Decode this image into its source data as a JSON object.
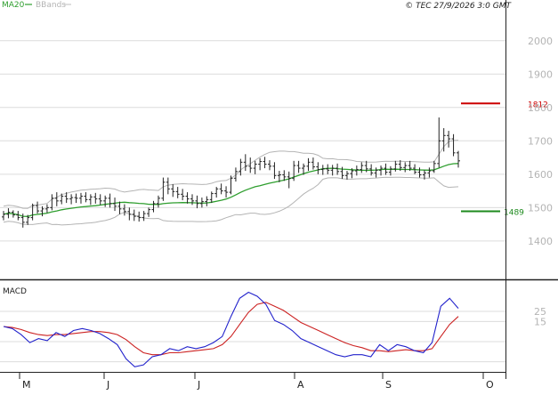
{
  "header": {
    "legend_ma": "MA20",
    "legend_bb": "BBands",
    "copyright": "© TEC 27/9/2026 3:0 GMT"
  },
  "colors": {
    "price_bar": "#222222",
    "ma20": "#2e9e2e",
    "bbands": "#b4b4b4",
    "macd_line": "#2222cc",
    "signal_line": "#cc2222",
    "resistance": "#cc0000",
    "support": "#1e8a1e",
    "grid": "#dcdcdc",
    "axis_text": "#b4b4b4"
  },
  "chart_data": [
    {
      "type": "line",
      "name": "price",
      "ylim": [
        1285,
        2090
      ],
      "yticks": [
        1400,
        1500,
        1600,
        1700,
        1800,
        1900,
        2000
      ],
      "x_months": [
        "M",
        "J",
        "J",
        "A",
        "S",
        "O"
      ],
      "levels": [
        {
          "label": "1812",
          "value": 1812
        },
        {
          "label": "1489",
          "value": 1489
        }
      ],
      "grid": true,
      "ohlc": [
        [
          1472,
          1490,
          1462,
          1480
        ],
        [
          1480,
          1498,
          1468,
          1486
        ],
        [
          1486,
          1492,
          1470,
          1478
        ],
        [
          1478,
          1490,
          1462,
          1470
        ],
        [
          1470,
          1482,
          1440,
          1456
        ],
        [
          1456,
          1478,
          1448,
          1470
        ],
        [
          1470,
          1512,
          1462,
          1506
        ],
        [
          1506,
          1518,
          1482,
          1490
        ],
        [
          1490,
          1504,
          1474,
          1496
        ],
        [
          1496,
          1510,
          1484,
          1500
        ],
        [
          1500,
          1540,
          1492,
          1528
        ],
        [
          1528,
          1546,
          1504,
          1520
        ],
        [
          1520,
          1542,
          1510,
          1534
        ],
        [
          1534,
          1546,
          1514,
          1526
        ],
        [
          1526,
          1540,
          1510,
          1530
        ],
        [
          1530,
          1542,
          1514,
          1528
        ],
        [
          1528,
          1544,
          1512,
          1534
        ],
        [
          1534,
          1546,
          1516,
          1524
        ],
        [
          1524,
          1540,
          1508,
          1532
        ],
        [
          1532,
          1544,
          1512,
          1526
        ],
        [
          1526,
          1540,
          1508,
          1520
        ],
        [
          1520,
          1536,
          1502,
          1528
        ],
        [
          1528,
          1542,
          1500,
          1512
        ],
        [
          1512,
          1530,
          1490,
          1504
        ],
        [
          1504,
          1518,
          1480,
          1496
        ],
        [
          1496,
          1510,
          1476,
          1488
        ],
        [
          1488,
          1500,
          1462,
          1480
        ],
        [
          1480,
          1494,
          1460,
          1474
        ],
        [
          1474,
          1488,
          1458,
          1470
        ],
        [
          1470,
          1490,
          1460,
          1482
        ],
        [
          1482,
          1500,
          1472,
          1494
        ],
        [
          1494,
          1520,
          1486,
          1512
        ],
        [
          1512,
          1536,
          1500,
          1528
        ],
        [
          1528,
          1590,
          1520,
          1576
        ],
        [
          1576,
          1590,
          1540,
          1556
        ],
        [
          1556,
          1570,
          1532,
          1548
        ],
        [
          1548,
          1562,
          1528,
          1540
        ],
        [
          1540,
          1556,
          1522,
          1534
        ],
        [
          1534,
          1546,
          1512,
          1526
        ],
        [
          1526,
          1540,
          1508,
          1520
        ],
        [
          1520,
          1536,
          1498,
          1512
        ],
        [
          1512,
          1530,
          1500,
          1518
        ],
        [
          1518,
          1534,
          1504,
          1524
        ],
        [
          1524,
          1548,
          1514,
          1542
        ],
        [
          1542,
          1562,
          1530,
          1556
        ],
        [
          1556,
          1572,
          1540,
          1550
        ],
        [
          1550,
          1564,
          1530,
          1546
        ],
        [
          1546,
          1596,
          1540,
          1588
        ],
        [
          1588,
          1620,
          1578,
          1608
        ],
        [
          1608,
          1646,
          1596,
          1636
        ],
        [
          1636,
          1660,
          1610,
          1624
        ],
        [
          1624,
          1650,
          1604,
          1618
        ],
        [
          1618,
          1640,
          1600,
          1630
        ],
        [
          1630,
          1648,
          1612,
          1638
        ],
        [
          1638,
          1652,
          1618,
          1630
        ],
        [
          1630,
          1642,
          1612,
          1624
        ],
        [
          1624,
          1636,
          1586,
          1596
        ],
        [
          1596,
          1610,
          1576,
          1598
        ],
        [
          1598,
          1612,
          1580,
          1592
        ],
        [
          1592,
          1608,
          1558,
          1588
        ],
        [
          1588,
          1640,
          1580,
          1626
        ],
        [
          1626,
          1640,
          1604,
          1618
        ],
        [
          1618,
          1632,
          1598,
          1624
        ],
        [
          1624,
          1648,
          1610,
          1636
        ],
        [
          1636,
          1650,
          1614,
          1622
        ],
        [
          1622,
          1636,
          1600,
          1614
        ],
        [
          1614,
          1628,
          1598,
          1616
        ],
        [
          1616,
          1630,
          1600,
          1612
        ],
        [
          1612,
          1628,
          1596,
          1618
        ],
        [
          1618,
          1632,
          1598,
          1608
        ],
        [
          1608,
          1622,
          1586,
          1596
        ],
        [
          1596,
          1610,
          1584,
          1602
        ],
        [
          1602,
          1618,
          1588,
          1610
        ],
        [
          1610,
          1626,
          1596,
          1614
        ],
        [
          1614,
          1636,
          1604,
          1626
        ],
        [
          1626,
          1640,
          1606,
          1616
        ],
        [
          1616,
          1630,
          1596,
          1604
        ],
        [
          1604,
          1620,
          1590,
          1612
        ],
        [
          1612,
          1626,
          1596,
          1618
        ],
        [
          1618,
          1632,
          1598,
          1606
        ],
        [
          1606,
          1624,
          1596,
          1616
        ],
        [
          1616,
          1640,
          1608,
          1630
        ],
        [
          1630,
          1642,
          1610,
          1620
        ],
        [
          1620,
          1636,
          1606,
          1626
        ],
        [
          1626,
          1640,
          1610,
          1618
        ],
        [
          1618,
          1630,
          1600,
          1606
        ],
        [
          1606,
          1620,
          1590,
          1598
        ],
        [
          1598,
          1612,
          1584,
          1604
        ],
        [
          1604,
          1620,
          1590,
          1610
        ],
        [
          1610,
          1640,
          1604,
          1632
        ],
        [
          1632,
          1770,
          1620,
          1700
        ],
        [
          1700,
          1738,
          1668,
          1716
        ],
        [
          1716,
          1730,
          1680,
          1706
        ],
        [
          1706,
          1720,
          1654,
          1664
        ],
        [
          1664,
          1670,
          1620,
          1640
        ]
      ]
    },
    {
      "type": "line",
      "title": "MACD",
      "ylim": [
        -35,
        55
      ],
      "yticks": [
        {
          "value": 25,
          "label": "25"
        },
        {
          "value": 15,
          "label": "15"
        }
      ],
      "series": [
        {
          "key": "macd",
          "values": [
            10,
            8,
            2,
            -6,
            -2,
            -4,
            4,
            0,
            6,
            8,
            6,
            3,
            -2,
            -8,
            -22,
            -30,
            -28,
            -20,
            -18,
            -12,
            -14,
            -10,
            -12,
            -10,
            -6,
            0,
            20,
            38,
            44,
            40,
            32,
            16,
            12,
            6,
            -2,
            -6,
            -10,
            -14,
            -18,
            -20,
            -18,
            -18,
            -20,
            -8,
            -14,
            -8,
            -10,
            -14,
            -16,
            -6,
            30,
            38,
            28
          ]
        },
        {
          "key": "signal",
          "values": [
            10,
            9,
            7,
            4,
            2,
            1,
            2,
            2,
            3,
            4,
            5,
            5,
            4,
            2,
            -3,
            -10,
            -16,
            -18,
            -18,
            -16,
            -16,
            -15,
            -14,
            -13,
            -12,
            -8,
            0,
            12,
            24,
            32,
            34,
            30,
            26,
            20,
            14,
            10,
            6,
            2,
            -2,
            -6,
            -9,
            -11,
            -14,
            -14,
            -15,
            -14,
            -13,
            -14,
            -14,
            -12,
            0,
            12,
            20
          ]
        }
      ]
    }
  ]
}
